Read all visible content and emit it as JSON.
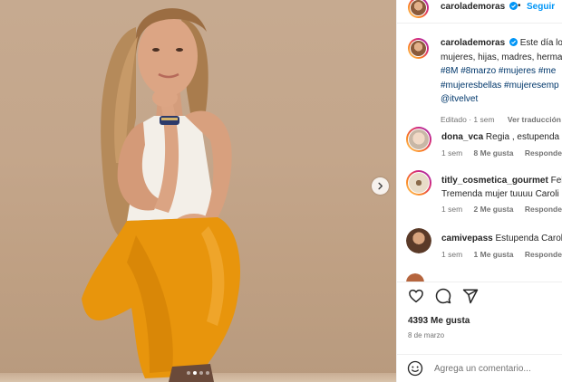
{
  "post": {
    "author": "carolademoras",
    "follow_label": "Seguir",
    "separator": "•",
    "image": {
      "dots_count": 4,
      "active_dot": 1
    },
    "caption": {
      "username": "carolademoras",
      "line1": "Este día lo",
      "line2": "mujeres, hijas, madres, herma",
      "line3": "#8M #8marzo #mujeres #me",
      "line4": "#mujeresbellas #mujeresemp",
      "line5": "@itvelvet",
      "meta_time": "Editado · 1 sem",
      "meta_translate": "Ver traducción"
    },
    "comments": [
      {
        "username": "dona_vca",
        "text": "Regia , estupenda .",
        "time": "1 sem",
        "likes": "8 Me gusta",
        "reply": "Responder",
        "avatar_color": "#e6d4c4"
      },
      {
        "username": "titly_cosmetica_gourmet",
        "text": "Feli",
        "text2": "Tremenda mujer tuuuu Caroli",
        "time": "1 sem",
        "likes": "2 Me gusta",
        "reply": "Responder",
        "avatar_color": "#d9cdb8"
      },
      {
        "username": "camivepass",
        "text": "Estupenda Carola",
        "time": "1 sem",
        "likes": "1 Me gusta",
        "reply": "Responder",
        "avatar_color": "#8a6f5a"
      }
    ],
    "likes_label": "4393 Me gusta",
    "date_label": "8 de marzo",
    "comment_placeholder": "Agrega un comentario..."
  },
  "icons": {
    "like": "heart-icon",
    "comment": "comment-icon",
    "share": "send-icon",
    "emoji": "emoji-icon",
    "next": "chevron-right-icon",
    "verified": "verified-badge-icon"
  },
  "colors": {
    "link_blue": "#0095f6",
    "hashtag": "#00376b",
    "muted": "#737373",
    "pants": "#e6930f",
    "background_wall": "#c4a68b"
  }
}
